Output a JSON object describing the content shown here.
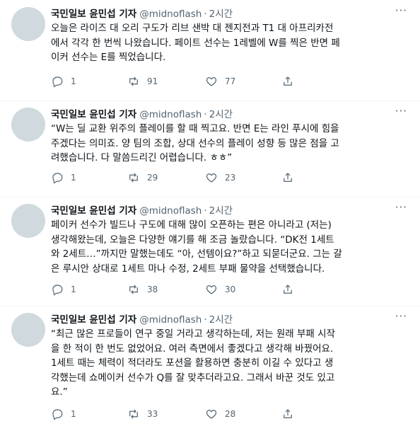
{
  "tweets": [
    {
      "name": "국민일보 윤민섭 기자",
      "handle": "@midnoflash",
      "time": "2시간",
      "lines": [
        "오늘은 라이즈 대 오리 구도가 리브 샌박 대 젠지전과 T1 대 아프리카전",
        "에서 각각 한 번씩 나왔습니다. 페이트 선수는 1레벨에 W를 찍은 반면 페",
        "이커 선수는 E를 찍었습니다."
      ],
      "replies": "1",
      "retweets": "91",
      "likes": "77"
    },
    {
      "name": "국민일보 윤민섭 기자",
      "handle": "@midnoflash",
      "time": "2시간",
      "lines": [
        "“W는 딜 교환 위주의 플레이를 할 때 찍고요. 반면 E는 라인 푸시에 힘을",
        "주겠다는 의미죠. 양 팀의 조합, 상대 선수의 플레이 성향 등 많은 점을 고",
        "려했습니다. 다 말씀드리긴 어렵습니다. ㅎㅎ”"
      ],
      "replies": "1",
      "retweets": "29",
      "likes": "23"
    },
    {
      "name": "국민일보 윤민섭 기자",
      "handle": "@midnoflash",
      "time": "2시간",
      "lines": [
        "페이커 선수가 빌드나 구도에 대해 많이 오픈하는 편은 아니라고 (저는)",
        "생각해왔는데, 오늘은 다양한 얘기를 해 조금 놀랐습니다. “DK전 1세트",
        "와 2세트…”까지만 말했는데도 “아, 선템이요?”하고 되묻더군요. 그는 갈",
        "은 루시안 상대로 1세트 마나 수정, 2세트 부패 물약을 선택했습니다."
      ],
      "replies": "1",
      "retweets": "38",
      "likes": "30"
    },
    {
      "name": "국민일보 윤민섭 기자",
      "handle": "@midnoflash",
      "time": "2시간",
      "lines": [
        "“최근 많은 프로들이 연구 중일 거라고 생각하는데, 저는 원래 부패 시작",
        "을 한 적이 한 번도 없었어요. 여러 측면에서 좋겠다고 생각해 바꿨어요.",
        "1세트 때는 체력이 적더라도 포션을 활용하면 충분히 이길 수 있다고 생",
        "각했는데 쇼메이커 선수가 Q를 잘 맞추더라고요. 그래서 바꾼 것도 있고",
        "요.”"
      ],
      "replies": "1",
      "retweets": "33",
      "likes": "28"
    }
  ]
}
